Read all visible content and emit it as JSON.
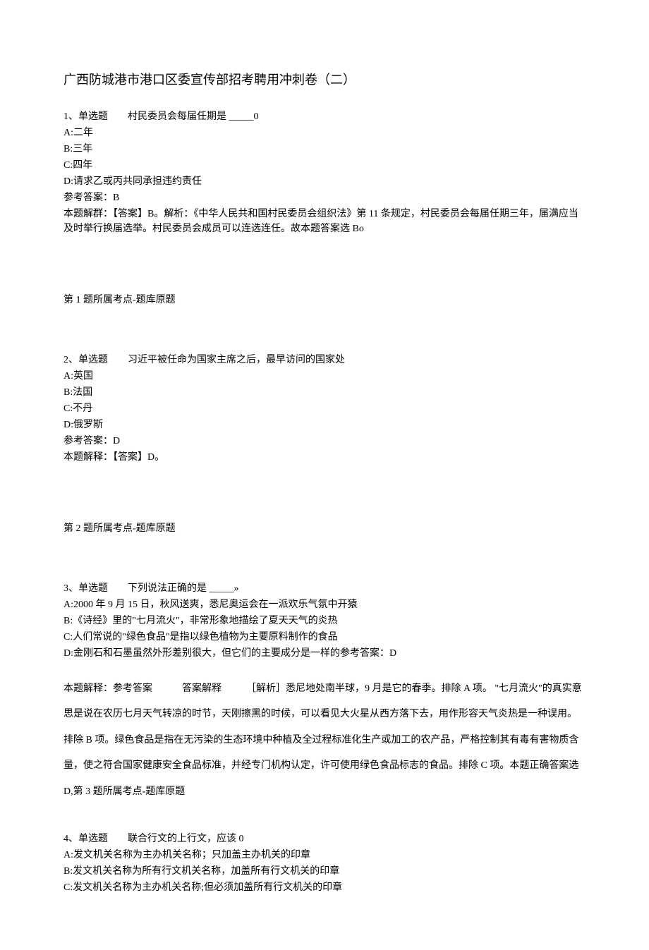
{
  "title": "广西防城港市港口区委宣传部招考聘用冲刺卷（二）",
  "q1": {
    "stem": "1、单选题　　村民委员会每届任期是 _____0",
    "optA": "A:二年",
    "optB": "B:三年",
    "optC": "C:四年",
    "optD": "D:请求乙或丙共同承担违约责任",
    "ans": "参考答案：B",
    "explain": "本题解群：【答案】B。解析：《中华人民共和国村民委员会组织法》第 11 条规定，村民委员会每届任期三年，届满应当及时举行换届选举。村民委员会成员可以连选连任。故本题答案选 Bo",
    "topic": "第 1 题所属考点-题库原题"
  },
  "q2": {
    "stem": "2、单选题　　习近平被任命为国家主席之后，最早访问的国家处",
    "optA": "A:英国",
    "optB": "B:法国",
    "optC": "C:不丹",
    "optD": "D:俄罗斯",
    "ans": "参考答案：D",
    "explain": "本题解释：【答案】D。",
    "topic": "第 2 题所属考点-题库原题"
  },
  "q3": {
    "stem": "3、单选题　　下列说法正确的是 _____»",
    "optA": "A:2000 年 9 月 15 日，秋风送爽，悉尼奥运会在一派欢乐气氛中开猿",
    "optB": "B:《诗经》里的\"七月流火\"，非常形象地描绘了夏天天气的炎热",
    "optC": "C:人们常说的\"绿色食品\"是指以绿色植物为主要原料制作的食品",
    "optD": "D:金刚石和石墨虽然外形差别很大，但它们的主要成分是一样的参考答案：D",
    "explain": "本题解释：参考答案　　　答案解释　　　［解析］悉尼地处南半球，9 月是它的春季。排除 A 项。 \"七月流火\"的真实意思是说在农历七月天气转凉的时节，天刚擦黑的时候，可以看见大火星从西方落下去，用作形容天气炎热是一种误用。排除 B 项。绿色食品是指在无污染的生态环境中种植及全过程标准化生产或加工的农产品，严格控制其有毒有害物质含量，使之符合国家健康安全食品标准，并经专门机构认定，许可使用绿色食品标志的食品。排除 C 项。本题正确答案选 D,第 3 题所属考点-题库原题"
  },
  "q4": {
    "stem": "4、单选题　　联合行文的上行文，应该 0",
    "optA": "A:发文机关名称为主办机关名称；只加盖主办机关的印章",
    "optB": "B:发文机关名称为所有行文机关名称，加盖所有行文机关的印章",
    "optC": "C:发文机关名称为主办机关名称;但必须加盖所有行文机关的印章"
  }
}
